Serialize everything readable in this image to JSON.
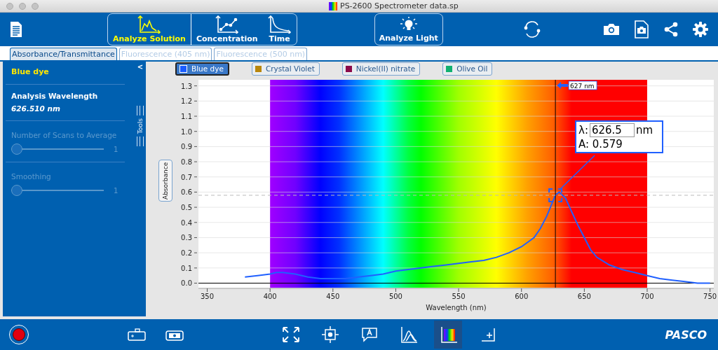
{
  "window": {
    "title": "PS-2600 Spectrometer data.sp"
  },
  "toolbar": {
    "modes": [
      {
        "label": "Analyze Solution",
        "selected": true
      },
      {
        "label": "Concentration",
        "selected": false
      },
      {
        "label": "Time",
        "selected": false
      }
    ],
    "analyze_light": "Analyze Light"
  },
  "tabs": [
    {
      "label": "Absorbance/Transmittance",
      "selected": true
    },
    {
      "label": "Fluorescence (405 nm)",
      "selected": false
    },
    {
      "label": "Fluorescence (500 nm)",
      "selected": false
    }
  ],
  "sidebar": {
    "collapse": "<",
    "sample": "Blue dye",
    "wavelength_label": "Analysis Wavelength",
    "wavelength_value": "626.510 nm",
    "tools_label": "Tools",
    "sliders": [
      {
        "label": "Number of Scans to Average",
        "value": "1",
        "level": 0,
        "disabled": true
      },
      {
        "label": "Smoothing",
        "value": "1",
        "level": 0,
        "disabled": true
      }
    ]
  },
  "samples": [
    {
      "name": "Blue dye",
      "color": "#1a5cff",
      "selected": true
    },
    {
      "name": "Crystal Violet",
      "color": "#b8860b",
      "selected": false
    },
    {
      "name": "Nickel(II) nitrate",
      "color": "#8b0a4a",
      "selected": false
    },
    {
      "name": "Olive Oil",
      "color": "#10b070",
      "selected": false
    }
  ],
  "chart": {
    "chart_data": {
      "type": "line",
      "xlabel": "Wavelength (nm)",
      "ylabel": "Absorbance",
      "grid": true,
      "x": [
        380,
        390,
        400,
        405,
        410,
        420,
        430,
        440,
        450,
        460,
        470,
        480,
        490,
        500,
        510,
        520,
        530,
        540,
        550,
        560,
        570,
        580,
        590,
        600,
        605,
        610,
        615,
        620,
        623,
        627,
        630,
        635,
        640,
        645,
        650,
        655,
        660,
        670,
        680,
        690,
        700,
        710,
        720,
        730,
        740,
        750
      ],
      "series": [
        {
          "color": "#2060ff",
          "values": [
            0.04,
            0.05,
            0.06,
            0.07,
            0.07,
            0.06,
            0.04,
            0.03,
            0.03,
            0.03,
            0.04,
            0.05,
            0.06,
            0.08,
            0.09,
            0.1,
            0.11,
            0.12,
            0.13,
            0.14,
            0.15,
            0.17,
            0.2,
            0.24,
            0.27,
            0.3,
            0.36,
            0.44,
            0.5,
            0.58,
            0.6,
            0.56,
            0.47,
            0.38,
            0.3,
            0.22,
            0.17,
            0.12,
            0.09,
            0.07,
            0.05,
            0.03,
            0.02,
            0.01,
            0.0,
            0.0
          ]
        }
      ],
      "xlim": [
        343,
        753
      ],
      "ylim": [
        -0.03,
        1.34
      ],
      "xticks": [
        350,
        400,
        450,
        500,
        550,
        600,
        650,
        700,
        750
      ],
      "yticks": [
        {
          "value": 0,
          "label": "0.0"
        },
        {
          "value": 0.1,
          "label": "0.1"
        },
        {
          "value": 0.2,
          "label": "0.2"
        },
        {
          "value": 0.3,
          "label": "0.3"
        },
        {
          "value": 0.4,
          "label": "0.4"
        },
        {
          "value": 0.5,
          "label": "0.5"
        },
        {
          "value": 0.6,
          "label": "0.6"
        },
        {
          "value": 0.7,
          "label": "0.7"
        },
        {
          "value": 0.8,
          "label": "0.8"
        },
        {
          "value": 0.9,
          "label": "0.9"
        },
        {
          "value": 1,
          "label": "1.0"
        },
        {
          "value": 1.1,
          "label": "1.1"
        },
        {
          "value": 1.2,
          "label": "1.2"
        },
        {
          "value": 1.3,
          "label": "1.3"
        }
      ],
      "ref_lines": [
        {
          "axis": "x",
          "value": 627,
          "label": "627 nm"
        },
        {
          "axis": "y",
          "value": 0.579
        }
      ],
      "bands": [
        {
          "axis": "x",
          "from": 400,
          "to": 700
        }
      ]
    },
    "readout": {
      "lambda_label": "λ:",
      "wavelength": "626.5",
      "unit": "nm",
      "absorbance": "A: 0.579"
    }
  },
  "bottom_tools": [
    {
      "selected": false
    },
    {
      "selected": false
    },
    {
      "selected": false
    },
    {
      "selected": false
    },
    {
      "selected": true
    },
    {
      "selected": false
    }
  ],
  "brand": "PASCO"
}
